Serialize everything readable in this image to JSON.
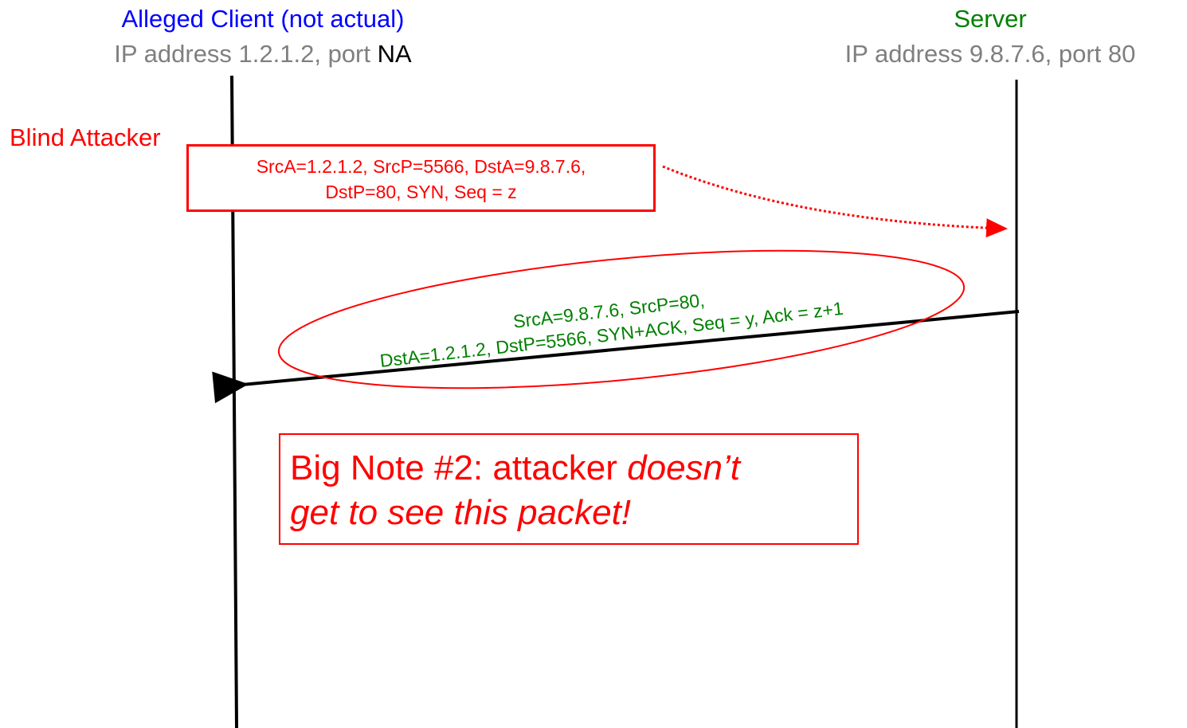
{
  "client": {
    "title": "Alleged Client (not actual)",
    "address_prefix": "IP address 1.2.1.2, port ",
    "port": "NA"
  },
  "server": {
    "title": "Server",
    "address": "IP address 9.8.7.6, port 80"
  },
  "attacker": {
    "label": "Blind Attacker"
  },
  "syn_packet": {
    "line1": "SrcA=1.2.1.2, SrcP=5566, DstA=9.8.7.6,",
    "line2": "DstP=80, SYN, Seq = z"
  },
  "synack_packet": {
    "line1": "SrcA=9.8.7.6, SrcP=80,",
    "line2": "DstA=1.2.1.2, DstP=5566, SYN+ACK, Seq = y, Ack = z+1"
  },
  "note": {
    "prefix": "Big Note #2: attacker ",
    "emphasis_1": "doesn’t",
    "emphasis_2": "get to see this packet!"
  },
  "colors": {
    "client": "#0000ff",
    "server": "#008000",
    "attacker": "#ff0000",
    "address": "#7f7f7f"
  }
}
